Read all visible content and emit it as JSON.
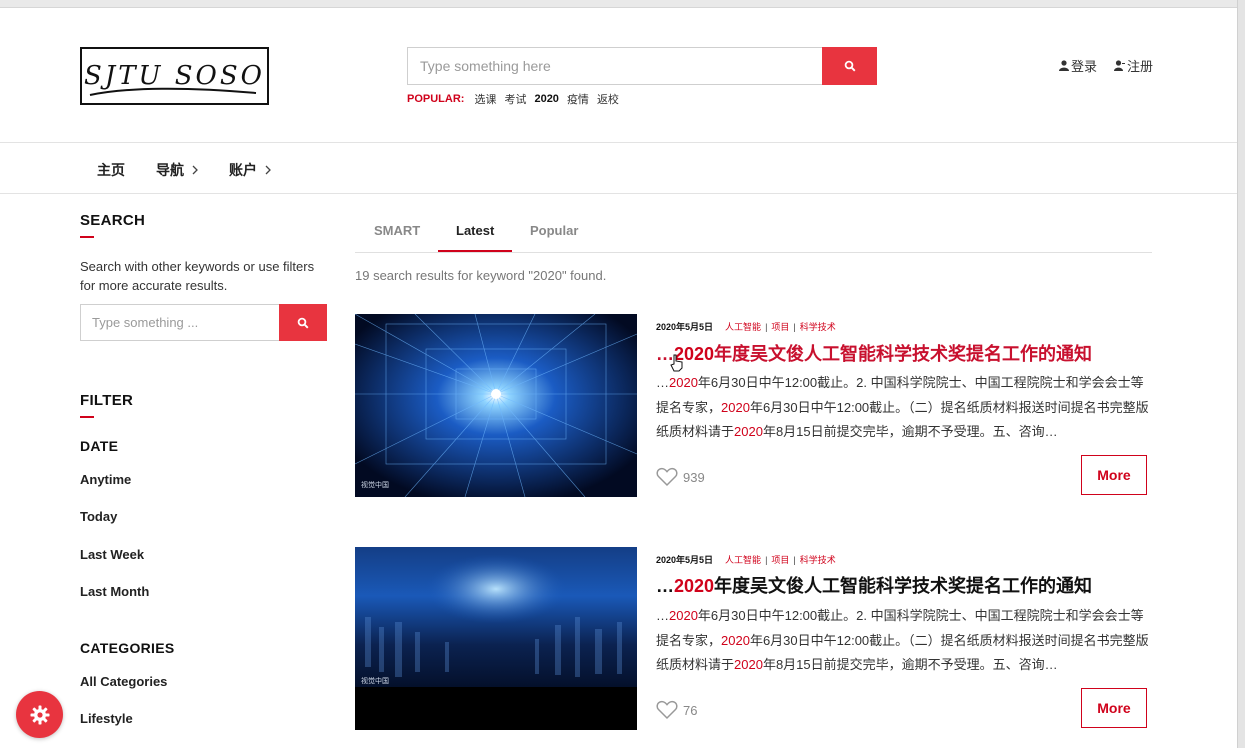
{
  "logo": {
    "text": "SJTU SOSO"
  },
  "search": {
    "placeholder": "Type something here"
  },
  "popular": {
    "label": "POPULAR:",
    "tags": [
      "选课",
      "考试",
      "2020",
      "疫情",
      "返校"
    ]
  },
  "auth": {
    "login": "登录",
    "register": "注册"
  },
  "nav": {
    "items": [
      "主页",
      "导航",
      "账户"
    ]
  },
  "sidebar": {
    "search_title": "SEARCH",
    "search_desc": "Search with other keywords or use filters for more accurate results.",
    "search_placeholder": "Type something ...",
    "filter_title": "FILTER",
    "date_title": "DATE",
    "date_options": [
      "Anytime",
      "Today",
      "Last Week",
      "Last Month"
    ],
    "categories_title": "CATEGORIES",
    "categories": [
      "All Categories",
      "Lifestyle"
    ]
  },
  "tabs": [
    "SMART",
    "Latest",
    "Popular"
  ],
  "results_info": "19 search results for keyword \"2020\" found.",
  "keyword": "2020",
  "results": [
    {
      "date": "2020年5月5日",
      "categories": [
        "人工智能",
        "项目",
        "科学技术"
      ],
      "title_prefix": "…",
      "title_kw": "2020",
      "title_rest": "年度吴文俊人工智能科学技术奖提名工作的通知",
      "excerpt": [
        {
          "t": "…"
        },
        {
          "k": "2020"
        },
        {
          "t": "年6月30日中午12:00截止。2. 中国科学院院士、中国工程院院士和学会会士等提名专家，"
        },
        {
          "k": "2020"
        },
        {
          "t": "年6月30日中午12:00截止。（二）提名纸质材料报送时间提名书完整版纸质材料请于"
        },
        {
          "k": "2020"
        },
        {
          "t": "年8月15日前提交完毕，逾期不予受理。五、咨询…"
        }
      ],
      "likes": "939",
      "image_watermark": "视觉中国",
      "more_label": "More"
    },
    {
      "date": "2020年5月5日",
      "categories": [
        "人工智能",
        "项目",
        "科学技术"
      ],
      "title_prefix": "…",
      "title_kw": "2020",
      "title_rest": "年度吴文俊人工智能科学技术奖提名工作的通知",
      "excerpt": [
        {
          "t": "…"
        },
        {
          "k": "2020"
        },
        {
          "t": "年6月30日中午12:00截止。2. 中国科学院院士、中国工程院院士和学会会士等提名专家，"
        },
        {
          "k": "2020"
        },
        {
          "t": "年6月30日中午12:00截止。（二）提名纸质材料报送时间提名书完整版纸质材料请于"
        },
        {
          "k": "2020"
        },
        {
          "t": "年8月15日前提交完毕，逾期不予受理。五、咨询…"
        }
      ],
      "likes": "76",
      "image_watermark": "视觉中国",
      "more_label": "More"
    }
  ],
  "colors": {
    "accent": "#d0021b",
    "button": "#e8343f"
  },
  "icons": {
    "search": "search-icon",
    "user": "user-icon",
    "heart": "heart-icon",
    "gear": "gear-icon",
    "chevron": "chevron-right-icon"
  }
}
